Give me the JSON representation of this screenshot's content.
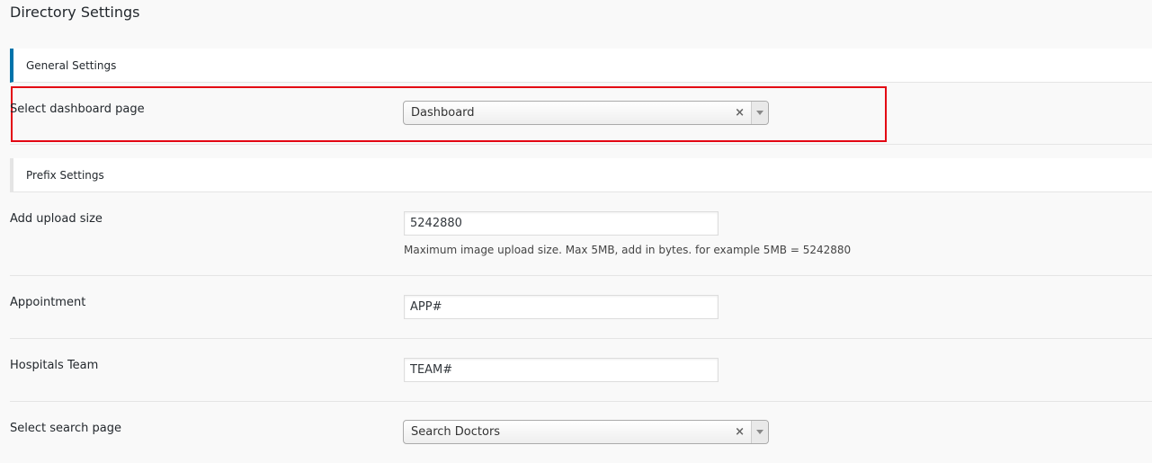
{
  "page": {
    "title": "Directory Settings"
  },
  "sections": {
    "general": {
      "label": "General Settings"
    },
    "prefix": {
      "label": "Prefix Settings"
    }
  },
  "fields": {
    "dashboard_page": {
      "label": "Select dashboard page",
      "value": "Dashboard",
      "clear_glyph": "×"
    },
    "upload_size": {
      "label": "Add upload size",
      "value": "5242880",
      "help": "Maximum image upload size. Max 5MB, add in bytes. for example 5MB = 5242880"
    },
    "appointment": {
      "label": "Appointment",
      "value": "APP#"
    },
    "hospitals_team": {
      "label": "Hospitals Team",
      "value": "TEAM#"
    },
    "search_page": {
      "label": "Select search page",
      "value": "Search Doctors",
      "clear_glyph": "×"
    }
  },
  "colors": {
    "accent": "#0073aa",
    "highlight": "#e30613",
    "background": "#f9f9f9"
  }
}
